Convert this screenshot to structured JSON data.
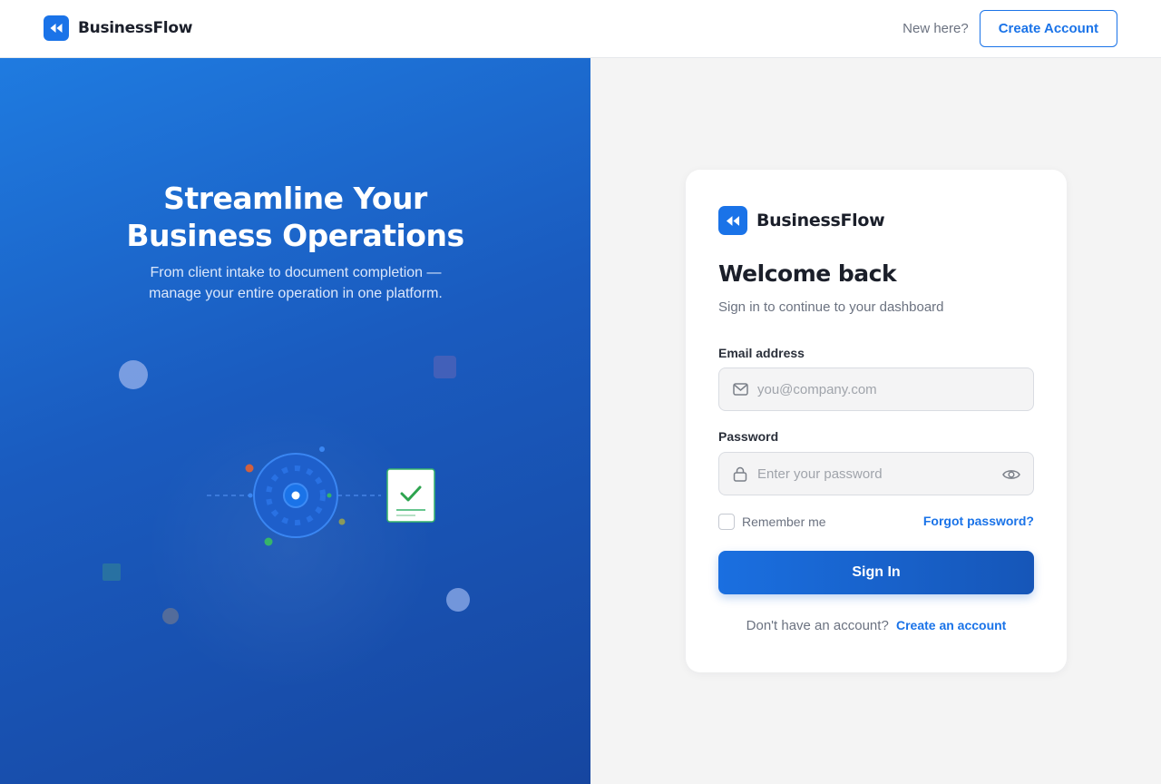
{
  "header": {
    "brand_name": "BusinessFlow",
    "new_here": "New here?",
    "create_account_label": "Create Account"
  },
  "hero": {
    "title_line1": "Streamline Your",
    "title_line2": "Business Operations",
    "subtitle": "From client intake to document completion — manage your entire operation in one platform."
  },
  "login": {
    "brand_name": "BusinessFlow",
    "title": "Welcome back",
    "subtitle": "Sign in to continue to your dashboard",
    "email_label": "Email address",
    "email_placeholder": "you@company.com",
    "email_value": "",
    "password_label": "Password",
    "password_placeholder": "Enter your password",
    "password_value": "",
    "remember_label": "Remember me",
    "remember_checked": false,
    "forgot_label": "Forgot password?",
    "signin_label": "Sign In",
    "no_account_text": "Don't have an account?",
    "create_link_label": "Create an account"
  },
  "icons": {
    "logo": "rewind-icon",
    "email": "envelope-icon",
    "password": "lock-icon",
    "toggle_password": "eye-icon",
    "hero_illustration": "gear-and-document-check-icon"
  },
  "colors": {
    "accent": "#1a73e8",
    "hero_gradient_start": "#1f7be0",
    "hero_gradient_end": "#1646a0",
    "check_green": "#2ea44f"
  }
}
